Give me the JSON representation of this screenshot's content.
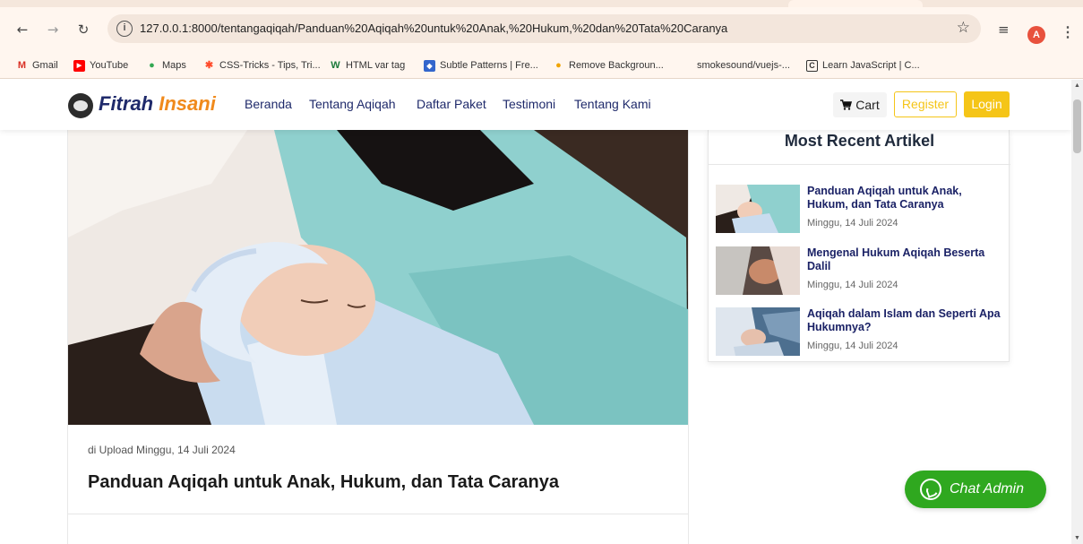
{
  "browser": {
    "url": "127.0.0.1:8000/tentangaqiqah/Panduan%20Aqiqah%20untuk%20Anak,%20Hukum,%20dan%20Tata%20Caranya",
    "profile_initial": "A",
    "bookmarks": [
      {
        "label": "Gmail",
        "icon": "gmail-icon",
        "color": "#d93025",
        "glyph": "M"
      },
      {
        "label": "YouTube",
        "icon": "youtube-icon",
        "color": "#ff0000",
        "glyph": "▶"
      },
      {
        "label": "Maps",
        "icon": "maps-icon",
        "color": "#34a853",
        "glyph": "●"
      },
      {
        "label": "CSS-Tricks - Tips, Tri...",
        "icon": "css-tricks-icon",
        "color": "#ff4b2b",
        "glyph": "✱"
      },
      {
        "label": "HTML var tag",
        "icon": "w3schools-icon",
        "color": "#1a7a3a",
        "glyph": "W"
      },
      {
        "label": "Subtle Patterns | Fre...",
        "icon": "subtle-patterns-icon",
        "color": "#3366cc",
        "glyph": "◆"
      },
      {
        "label": "Remove Backgroun...",
        "icon": "remove-bg-icon",
        "color": "#f0a400",
        "glyph": "●"
      },
      {
        "label": "smokesound/vuejs-...",
        "icon": "github-icon",
        "color": "#ffffff",
        "glyph": ""
      },
      {
        "label": "Learn JavaScript | C...",
        "icon": "codecademy-icon",
        "color": "#333333",
        "glyph": "C"
      }
    ]
  },
  "site": {
    "logo_part1": "Fitrah",
    "logo_part2": "Insani",
    "nav": [
      "Beranda",
      "Tentang Aqiqah",
      "Daftar Paket",
      "Testimoni",
      "Tentang Kami"
    ],
    "cart_label": "Cart",
    "register_label": "Register",
    "login_label": "Login",
    "colors": {
      "navy": "#1f2a6b",
      "orange": "#f08a1c",
      "yellow": "#f5c518",
      "green": "#2fa81f"
    }
  },
  "article": {
    "upload_text": "di Upload Minggu, 14 Juli 2024",
    "title": "Panduan Aqiqah untuk Anak, Hukum, dan Tata Caranya"
  },
  "sidebar": {
    "heading": "Most Recent Artikel",
    "items": [
      {
        "title": "Panduan Aqiqah untuk Anak, Hukum, dan Tata Caranya",
        "date": "Minggu, 14 Juli 2024"
      },
      {
        "title": "Mengenal Hukum Aqiqah Beserta Dalil",
        "date": "Minggu, 14 Juli 2024"
      },
      {
        "title": "Aqiqah dalam Islam dan Seperti Apa Hukumnya?",
        "date": "Minggu, 14 Juli 2024"
      }
    ]
  },
  "chat": {
    "label": "Chat Admin"
  }
}
